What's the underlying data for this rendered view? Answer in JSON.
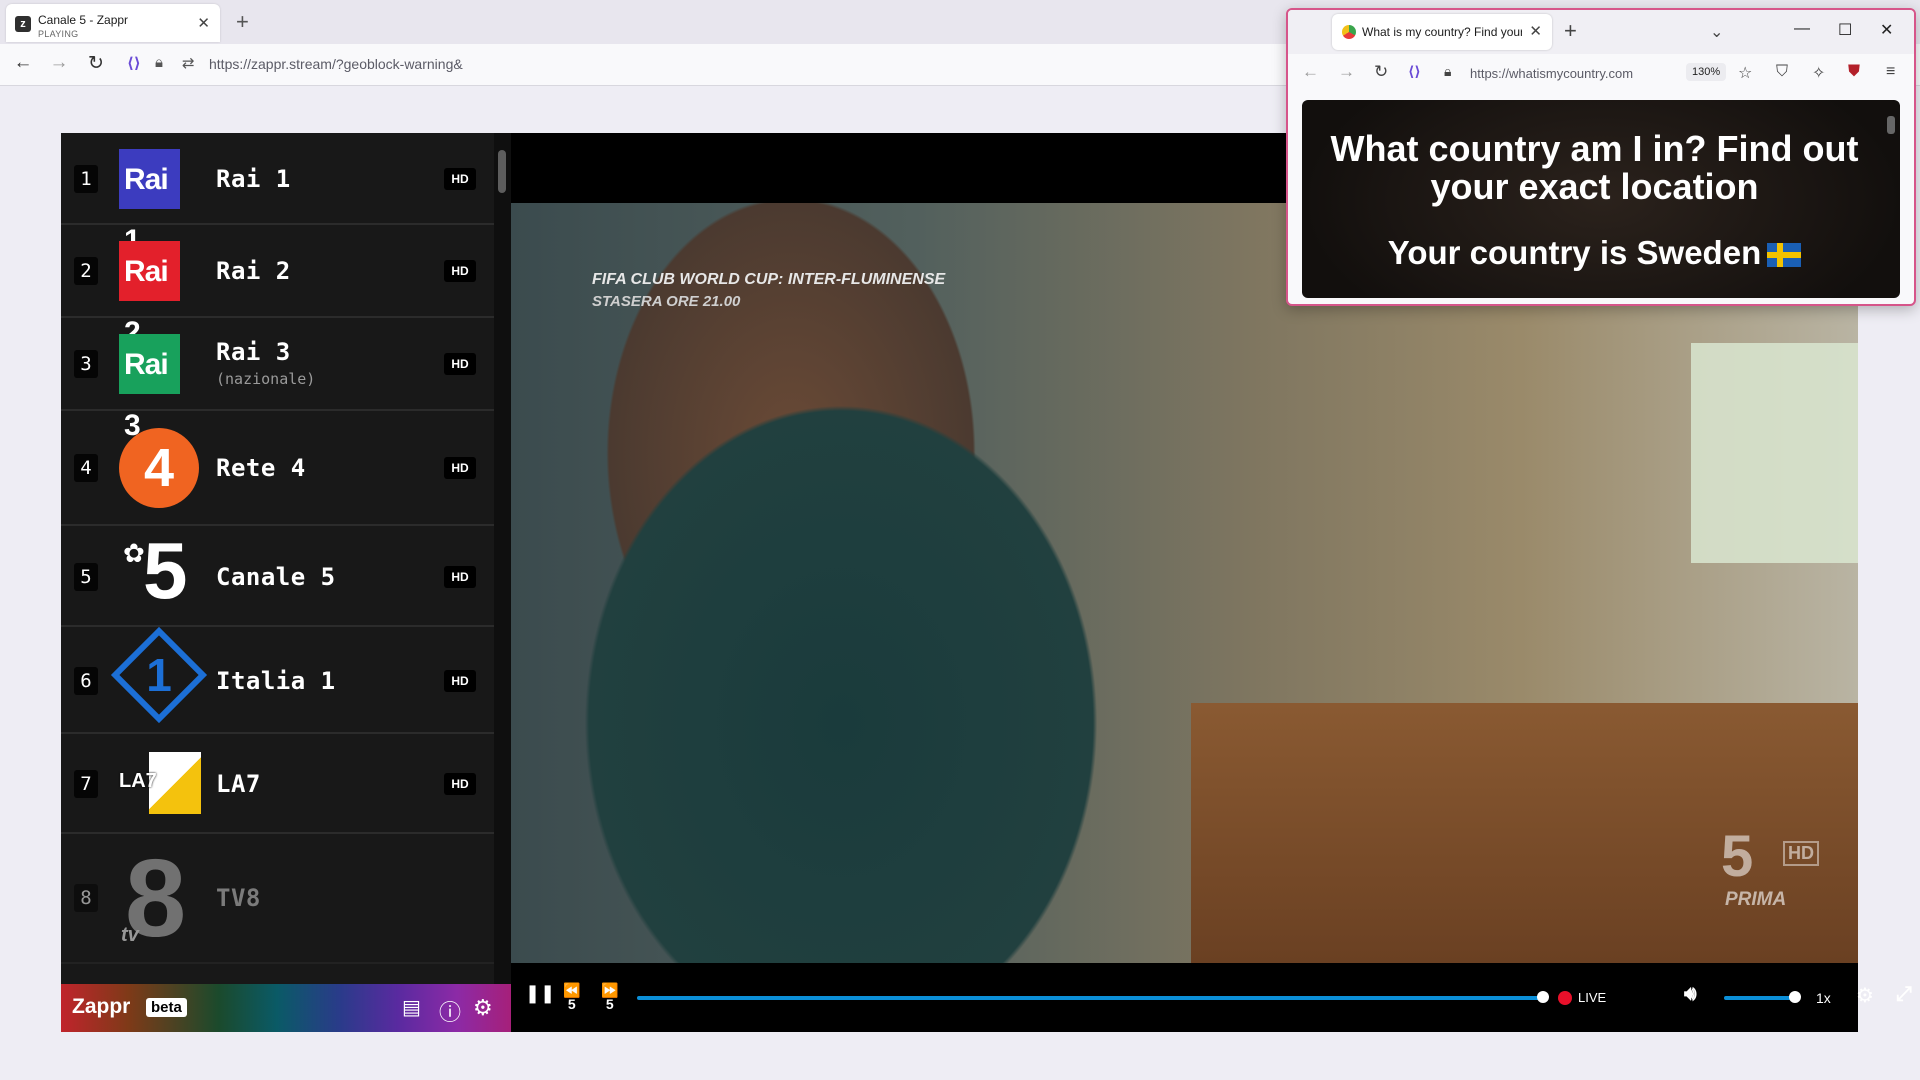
{
  "browser": {
    "tab_title": "Canale 5 - Zappr",
    "tab_status": "PLAYING",
    "url": "https://zappr.stream/?geoblock-warning&"
  },
  "channels": [
    {
      "num": "1",
      "name": "Rai 1",
      "sub": "",
      "hd": "HD",
      "logo_text": "Rai",
      "logo_digit": "1"
    },
    {
      "num": "2",
      "name": "Rai 2",
      "sub": "",
      "hd": "HD",
      "logo_text": "Rai",
      "logo_digit": "2"
    },
    {
      "num": "3",
      "name": "Rai 3",
      "sub": "(nazionale)",
      "hd": "HD",
      "logo_text": "Rai",
      "logo_digit": "3"
    },
    {
      "num": "4",
      "name": "Rete 4",
      "sub": "",
      "hd": "HD",
      "logo_text": "4"
    },
    {
      "num": "5",
      "name": "Canale 5",
      "sub": "",
      "hd": "HD",
      "logo_text": "5"
    },
    {
      "num": "6",
      "name": "Italia 1",
      "sub": "",
      "hd": "HD",
      "logo_text": "1"
    },
    {
      "num": "7",
      "name": "LA7",
      "sub": "",
      "hd": "HD",
      "logo_text": "LA7"
    },
    {
      "num": "8",
      "name": "TV8",
      "sub": "",
      "hd": "",
      "logo_text": "8"
    }
  ],
  "zappr": {
    "brand": "Zappr",
    "beta": "beta"
  },
  "video": {
    "overlay_line1": "FIFA CLUB WORLD CUP: INTER-FLUMINENSE",
    "overlay_line2": "STASERA ORE 21.00",
    "watermark_num": "5",
    "watermark_hd": "HD",
    "watermark_prima": "PRIMA"
  },
  "player": {
    "rewind_label": "5",
    "forward_label": "5",
    "live_label": "LIVE",
    "rate_label": "1x",
    "seek_progress": 1.0,
    "volume": 1.0
  },
  "popup": {
    "tab_title": "What is my country? Find your",
    "url": "https://whatismycountry.com",
    "zoom": "130%",
    "heading": "What country am I in? Find out your exact location",
    "result": "Your country is Sweden"
  },
  "colors": {
    "rai1": "#3c3cbf",
    "rai2": "#e3202b",
    "rai3": "#18a15c",
    "rete4": "#f06421",
    "italia1": "#1c6fd6",
    "live": "#e8102a",
    "seek": "#0b8fd8"
  }
}
